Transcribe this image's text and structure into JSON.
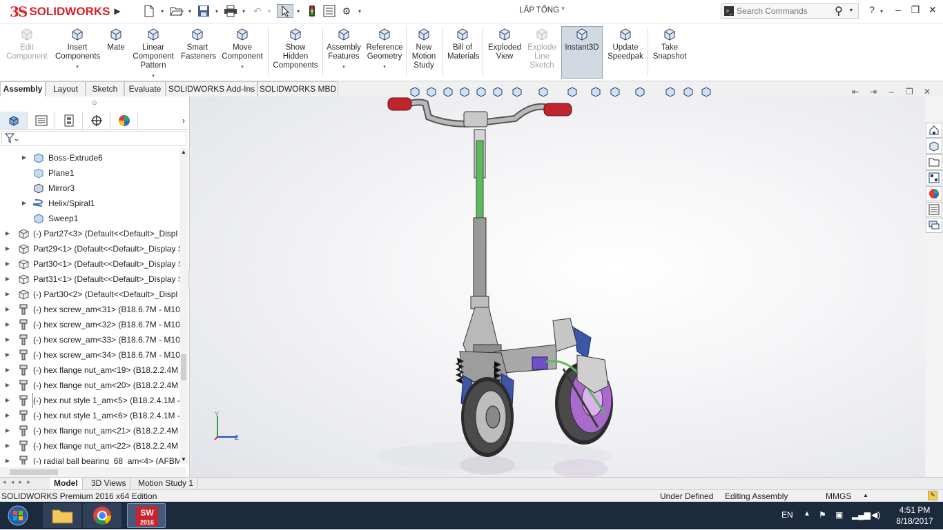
{
  "app": {
    "brand": "SOLIDWORKS",
    "document_title": "LẮP TỔNG *"
  },
  "search": {
    "placeholder": "Search Commands"
  },
  "title_controls": {
    "help": "?",
    "minimize": "–",
    "restore": "❐",
    "close": "✕"
  },
  "commands": [
    {
      "label": "Edit\nComponent",
      "icon": "edit-component-icon",
      "disabled": true
    },
    {
      "label": "Insert\nComponents",
      "icon": "insert-components-icon",
      "disabled": false
    },
    {
      "label": "Mate",
      "icon": "mate-icon",
      "disabled": false
    },
    {
      "label": "Linear\nComponent\nPattern",
      "icon": "linear-pattern-icon",
      "disabled": false
    },
    {
      "label": "Smart\nFasteners",
      "icon": "smart-fasteners-icon",
      "disabled": false
    },
    {
      "label": "Move\nComponent",
      "icon": "move-component-icon",
      "disabled": false
    },
    {
      "label": "Show\nHidden\nComponents",
      "icon": "show-hidden-icon",
      "disabled": false
    },
    {
      "label": "Assembly\nFeatures",
      "icon": "assembly-features-icon",
      "disabled": false
    },
    {
      "label": "Reference\nGeometry",
      "icon": "reference-geometry-icon",
      "disabled": false
    },
    {
      "label": "New\nMotion\nStudy",
      "icon": "motion-study-icon",
      "disabled": false
    },
    {
      "label": "Bill of\nMaterials",
      "icon": "bom-icon",
      "disabled": false
    },
    {
      "label": "Exploded\nView",
      "icon": "exploded-view-icon",
      "disabled": false
    },
    {
      "label": "Explode\nLine\nSketch",
      "icon": "explode-line-icon",
      "disabled": true
    },
    {
      "label": "Instant3D",
      "icon": "instant3d-icon",
      "disabled": false,
      "active": true
    },
    {
      "label": "Update\nSpeedpak",
      "icon": "speedpak-icon",
      "disabled": false
    },
    {
      "label": "Take\nSnapshot",
      "icon": "camera-icon",
      "disabled": false
    }
  ],
  "tabs": [
    "Assembly",
    "Layout",
    "Sketch",
    "Evaluate",
    "SOLIDWORKS Add-Ins",
    "SOLIDWORKS MBD"
  ],
  "tree": [
    {
      "label": "Boss-Extrude6",
      "indent": 1,
      "expander": true,
      "icon": "extrude"
    },
    {
      "label": "Plane1",
      "indent": 1,
      "expander": false,
      "icon": "plane"
    },
    {
      "label": "Mirror3",
      "indent": 1,
      "expander": false,
      "icon": "mirror"
    },
    {
      "label": "Helix/Spiral1",
      "indent": 1,
      "expander": true,
      "icon": "helix"
    },
    {
      "label": "Sweep1",
      "indent": 1,
      "expander": false,
      "icon": "sweep"
    },
    {
      "label": "(-) Part27<3> (Default<<Default>_Displ",
      "indent": 0,
      "expander": true,
      "icon": "part"
    },
    {
      "label": "Part29<1> (Default<<Default>_Display S",
      "indent": 0,
      "expander": true,
      "icon": "part"
    },
    {
      "label": "Part30<1> (Default<<Default>_Display S",
      "indent": 0,
      "expander": true,
      "icon": "part"
    },
    {
      "label": "Part31<1> (Default<<Default>_Display S",
      "indent": 0,
      "expander": true,
      "icon": "part"
    },
    {
      "label": "(-) Part30<2> (Default<<Default>_Displ",
      "indent": 0,
      "expander": true,
      "icon": "part"
    },
    {
      "label": "(-) hex screw_am<31> (B18.6.7M - M10",
      "indent": 0,
      "expander": true,
      "icon": "fastener"
    },
    {
      "label": "(-) hex screw_am<32> (B18.6.7M - M10",
      "indent": 0,
      "expander": true,
      "icon": "fastener"
    },
    {
      "label": "(-) hex screw_am<33> (B18.6.7M - M10",
      "indent": 0,
      "expander": true,
      "icon": "fastener"
    },
    {
      "label": "(-) hex screw_am<34> (B18.6.7M - M10",
      "indent": 0,
      "expander": true,
      "icon": "fastener"
    },
    {
      "label": "(-) hex flange nut_am<19> (B18.2.2.4M -",
      "indent": 0,
      "expander": true,
      "icon": "fastener"
    },
    {
      "label": "(-) hex flange nut_am<20> (B18.2.2.4M -",
      "indent": 0,
      "expander": true,
      "icon": "fastener"
    },
    {
      "label": "(-) hex nut style 1_am<5> (B18.2.4.1M -",
      "indent": 0,
      "expander": true,
      "icon": "fastener",
      "selected": true
    },
    {
      "label": "(-) hex nut style 1_am<6> (B18.2.4.1M -",
      "indent": 0,
      "expander": true,
      "icon": "fastener"
    },
    {
      "label": "(-) hex flange nut_am<21> (B18.2.2.4M -",
      "indent": 0,
      "expander": true,
      "icon": "fastener"
    },
    {
      "label": "(-) hex flange nut_am<22> (B18.2.2.4M -",
      "indent": 0,
      "expander": true,
      "icon": "fastener"
    },
    {
      "label": "(-) radial ball bearing_68_am<4> (AFBM",
      "indent": 0,
      "expander": true,
      "icon": "fastener"
    }
  ],
  "bottom_tabs": [
    "Model",
    "3D Views",
    "Motion Study 1"
  ],
  "status": {
    "edition": "SOLIDWORKS Premium 2016 x64 Edition",
    "definition": "Under Defined",
    "mode": "Editing Assembly",
    "units": "MMGS"
  },
  "taskbar": {
    "lang": "EN",
    "time": "4:51 PM",
    "date": "8/18/2017",
    "sw_badge": "2016"
  },
  "axes": {
    "y": "Y",
    "z": "Z"
  },
  "colors": {
    "brand_red": "#d8242a",
    "taskbar_bg": "#1c2a3d",
    "active_cmd": "#d3d9e1",
    "frame_green": "#5fb85f"
  }
}
